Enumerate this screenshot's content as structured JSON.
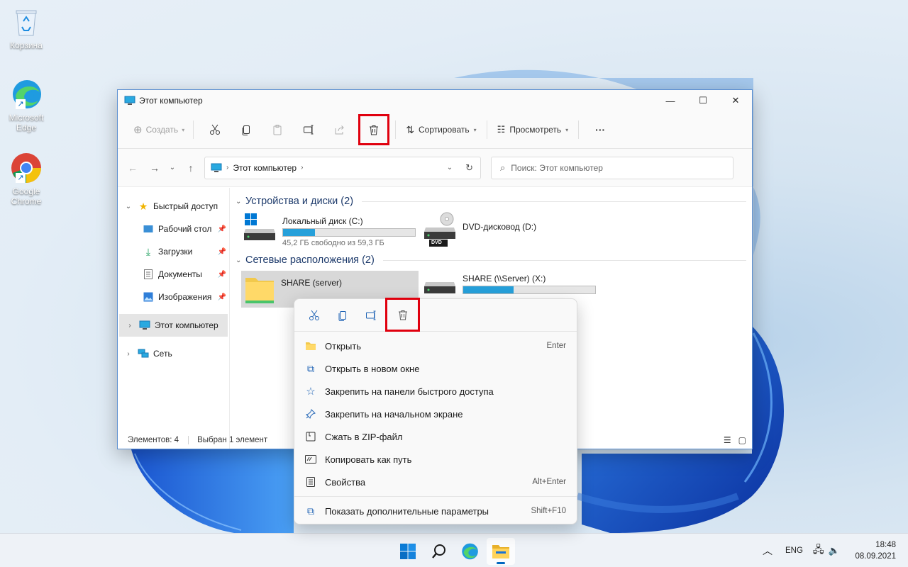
{
  "desktop": {
    "icons": [
      {
        "label": "Корзина"
      },
      {
        "label": "Microsoft Edge"
      },
      {
        "label": "Google Chrome"
      }
    ]
  },
  "window": {
    "title": "Этот компьютер",
    "caption": {
      "minimize": "—",
      "maximize": "☐",
      "close": "✕"
    },
    "toolbar": {
      "create": "Создать",
      "sort": "Сортировать",
      "view": "Просмотреть",
      "more": "···"
    },
    "address": {
      "path": "Этот компьютер",
      "search_placeholder": "Поиск: Этот компьютер"
    },
    "nav": {
      "quick_access": "Быстрый доступ",
      "desktop": "Рабочий стол",
      "downloads": "Загрузки",
      "documents": "Документы",
      "pictures": "Изображения",
      "this_pc": "Этот компьютер",
      "network": "Сеть"
    },
    "groups": {
      "devices": "Устройства и диски (2)",
      "network": "Сетевые расположения (2)"
    },
    "drives": {
      "c": {
        "name": "Локальный диск (C:)",
        "free": "45,2 ГБ свободно из 59,3 ГБ",
        "used_fraction": 0.24
      },
      "d": {
        "name": "DVD-дисковод (D:)",
        "badge": "DVD"
      },
      "share": {
        "name": "SHARE (server)"
      },
      "x": {
        "name": "SHARE (\\\\Server) (X:)",
        "used_fraction": 0.38
      }
    },
    "status": {
      "count": "Элементов: 4",
      "selected": "Выбран 1 элемент"
    }
  },
  "context_menu": {
    "items": [
      {
        "label": "Открыть",
        "shortcut": "Enter"
      },
      {
        "label": "Открыть в новом окне",
        "shortcut": ""
      },
      {
        "label": "Закрепить на панели быстрого доступа",
        "shortcut": ""
      },
      {
        "label": "Закрепить на начальном экране",
        "shortcut": ""
      },
      {
        "label": "Сжать в ZIP-файл",
        "shortcut": ""
      },
      {
        "label": "Копировать как путь",
        "shortcut": ""
      },
      {
        "label": "Свойства",
        "shortcut": "Alt+Enter"
      },
      {
        "label": "Показать дополнительные параметры",
        "shortcut": "Shift+F10"
      }
    ]
  },
  "taskbar": {
    "lang": "ENG",
    "time": "18:48",
    "date": "08.09.2021"
  },
  "colors": {
    "accent": "#0067c0",
    "highlight_box": "#e0000e",
    "progress": "#26a0da"
  }
}
